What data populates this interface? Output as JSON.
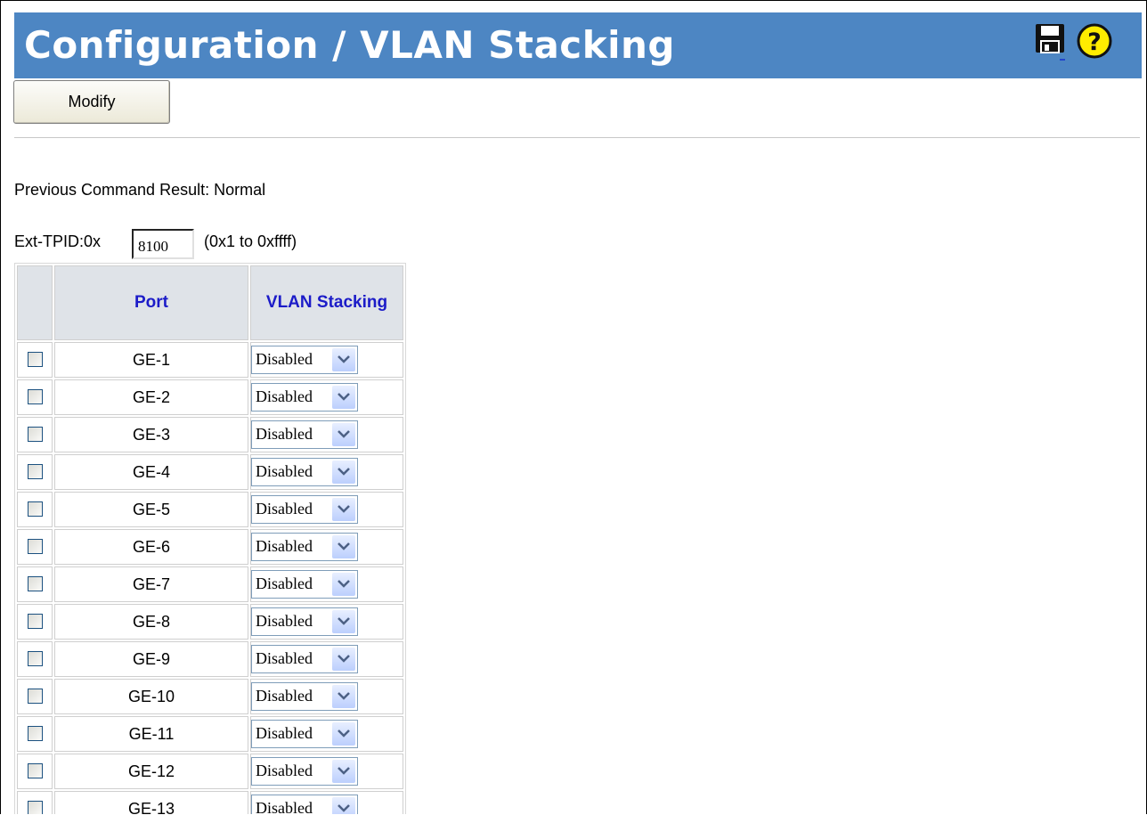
{
  "page": {
    "title": "Configuration / VLAN Stacking",
    "icons": {
      "save": "floppy-disk-save-icon",
      "help": "question-mark-help-icon"
    }
  },
  "toolbar": {
    "modify_label": "Modify"
  },
  "result": {
    "text": "Previous Command Result: Normal"
  },
  "tpid": {
    "prefix": "Ext-TPID:0x",
    "value": "8100",
    "range": "(0x1 to 0xffff)"
  },
  "table": {
    "headers": {
      "port": "Port",
      "vlan": "VLAN Stacking"
    },
    "rows": [
      {
        "port": "GE-1",
        "vlan": "Disabled"
      },
      {
        "port": "GE-2",
        "vlan": "Disabled"
      },
      {
        "port": "GE-3",
        "vlan": "Disabled"
      },
      {
        "port": "GE-4",
        "vlan": "Disabled"
      },
      {
        "port": "GE-5",
        "vlan": "Disabled"
      },
      {
        "port": "GE-6",
        "vlan": "Disabled"
      },
      {
        "port": "GE-7",
        "vlan": "Disabled"
      },
      {
        "port": "GE-8",
        "vlan": "Disabled"
      },
      {
        "port": "GE-9",
        "vlan": "Disabled"
      },
      {
        "port": "GE-10",
        "vlan": "Disabled"
      },
      {
        "port": "GE-11",
        "vlan": "Disabled"
      },
      {
        "port": "GE-12",
        "vlan": "Disabled"
      },
      {
        "port": "GE-13",
        "vlan": "Disabled"
      }
    ]
  },
  "colors": {
    "title_bar": "#4d86c3",
    "header_text": "#1c1cc8",
    "header_bg": "#dfe3e8"
  }
}
